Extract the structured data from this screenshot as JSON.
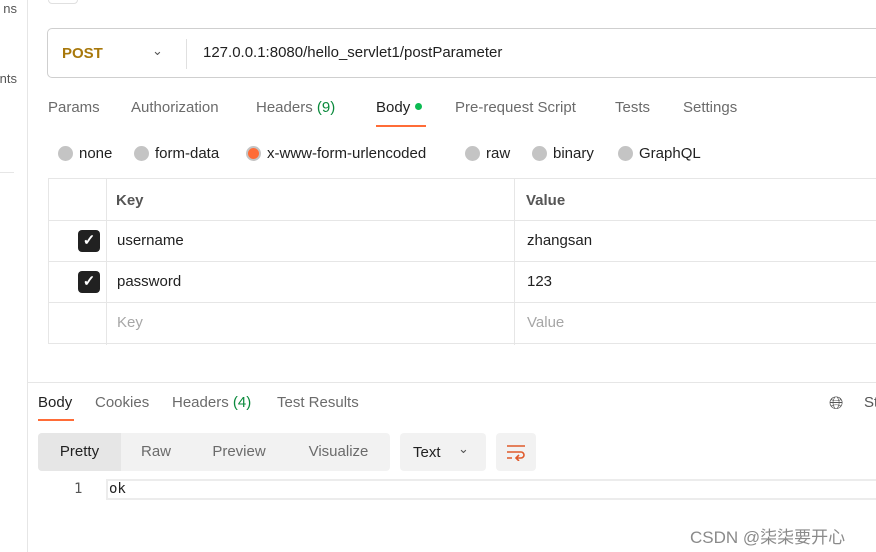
{
  "sidebar": {
    "items": [
      "ns",
      "nts"
    ]
  },
  "request": {
    "method": "POST",
    "url": "127.0.0.1:8080/hello_servlet1/postParameter"
  },
  "tabs": [
    {
      "label": "Params"
    },
    {
      "label": "Authorization"
    },
    {
      "label": "Headers",
      "count": "(9)"
    },
    {
      "label": "Body"
    },
    {
      "label": "Pre-request Script"
    },
    {
      "label": "Tests"
    },
    {
      "label": "Settings"
    }
  ],
  "body_types": [
    "none",
    "form-data",
    "x-www-form-urlencoded",
    "raw",
    "binary",
    "GraphQL"
  ],
  "body_type_selected": "x-www-form-urlencoded",
  "table": {
    "headers": [
      "Key",
      "Value"
    ],
    "rows": [
      {
        "key": "username",
        "value": "zhangsan",
        "checked": true
      },
      {
        "key": "password",
        "value": "123",
        "checked": true
      }
    ],
    "placeholder": {
      "key": "Key",
      "value": "Value"
    }
  },
  "response": {
    "tabs": [
      {
        "label": "Body"
      },
      {
        "label": "Cookies"
      },
      {
        "label": "Headers",
        "count": "(4)"
      },
      {
        "label": "Test Results"
      }
    ],
    "status_partial": "St",
    "views": [
      "Pretty",
      "Raw",
      "Preview",
      "Visualize"
    ],
    "format": "Text",
    "lines": [
      {
        "n": "1",
        "text": "ok"
      }
    ]
  },
  "watermark": "CSDN @柒柒要开心",
  "colors": {
    "accent": "#ff6c37",
    "method": "#a8780b",
    "count": "#0a8a3c"
  }
}
